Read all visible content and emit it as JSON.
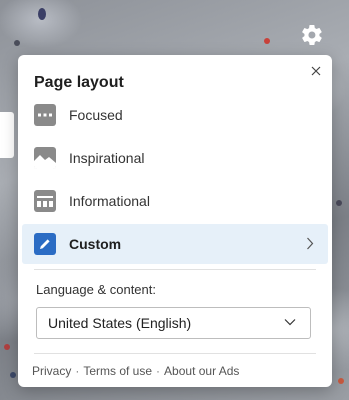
{
  "panel": {
    "title": "Page layout",
    "options": [
      {
        "label": "Focused"
      },
      {
        "label": "Inspirational"
      },
      {
        "label": "Informational"
      },
      {
        "label": "Custom"
      }
    ],
    "selected_option": "Custom",
    "language_label": "Language & content:",
    "language_value": "United States (English)",
    "footer_links": [
      "Privacy",
      "Terms of use",
      "About our Ads"
    ],
    "footer_separator": "·"
  },
  "colors": {
    "accent": "#2b6cc4",
    "selected_bg": "#e6f0f9",
    "icon_gray": "#8a8a8a"
  },
  "icons": {
    "settings": "gear-icon",
    "close": "close-icon",
    "focused": "focused-layout-icon",
    "inspirational": "inspirational-layout-icon",
    "informational": "informational-layout-icon",
    "custom": "pencil-icon",
    "chevron": "chevron-right-icon",
    "dropdown": "chevron-down-icon"
  }
}
